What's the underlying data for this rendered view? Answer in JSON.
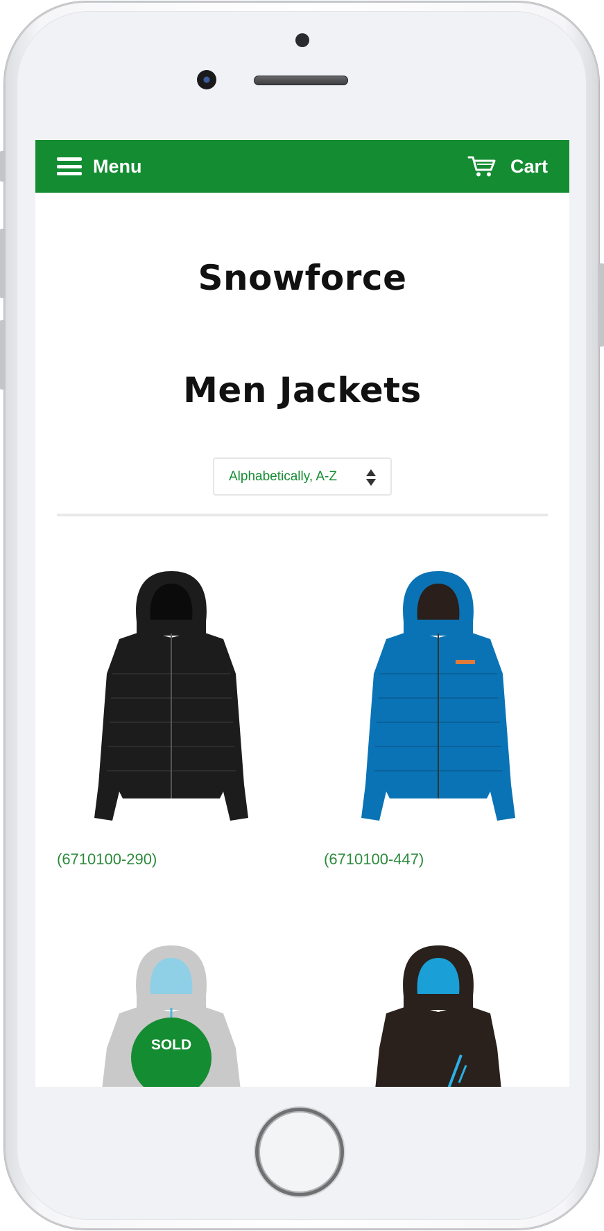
{
  "nav": {
    "menu_label": "Menu",
    "cart_label": "Cart",
    "bar_color": "#148c32"
  },
  "shop": {
    "title": "Snowforce"
  },
  "collection": {
    "title": "Men Jackets",
    "sort_value": "Alphabetically, A-Z"
  },
  "products": [
    {
      "sku": "(6710100-290)",
      "color": "#1c1c1c",
      "sold_out": false
    },
    {
      "sku": "(6710100-447)",
      "color": "#0a73b5",
      "sold_out": false
    },
    {
      "color": "#c9c9c9",
      "sold_out": true,
      "badge": "SOLD"
    },
    {
      "color": "#2a201c",
      "sold_out": false
    }
  ]
}
